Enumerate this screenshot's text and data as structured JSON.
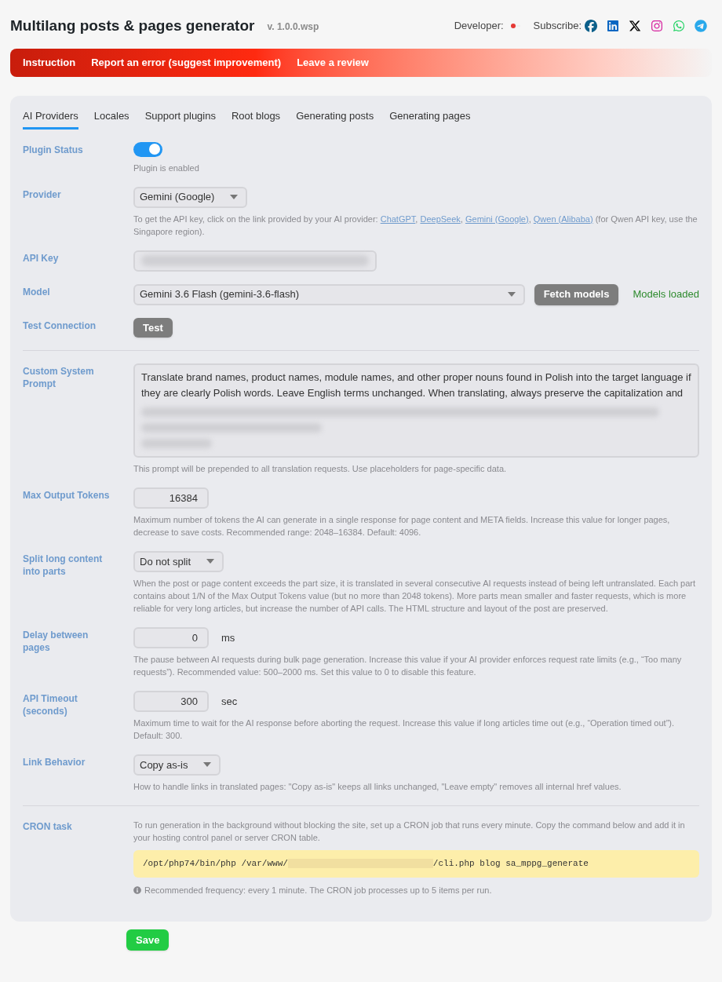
{
  "header": {
    "title": "Multilang posts & pages generator",
    "version": "v. 1.0.0.wsp",
    "developer_label": "Developer:",
    "subscribe_label": "Subscribe:"
  },
  "banner_links": [
    "Instruction",
    "Report an error (suggest improvement)",
    "Leave a review"
  ],
  "tabs": [
    {
      "label": "AI Providers",
      "selected": true
    },
    {
      "label": "Locales",
      "selected": false
    },
    {
      "label": "Support plugins",
      "selected": false
    },
    {
      "label": "Root blogs",
      "selected": false
    },
    {
      "label": "Generating posts",
      "selected": false
    },
    {
      "label": "Generating pages",
      "selected": false
    }
  ],
  "rows": [
    {
      "kind": "toggle",
      "label": "Plugin Status",
      "on": true,
      "help": "Plugin is enabled"
    },
    {
      "kind": "select",
      "label": "Provider",
      "value": "Gemini (Google)",
      "help_parts": [
        {
          "kind": "text",
          "text": "To get the API key, click on the link provided by your AI provider: "
        },
        {
          "kind": "link",
          "text": "ChatGPT"
        },
        {
          "kind": "text",
          "text": ", "
        },
        {
          "kind": "link",
          "text": "DeepSeek"
        },
        {
          "kind": "text",
          "text": ", "
        },
        {
          "kind": "link",
          "text": "Gemini (Google)"
        },
        {
          "kind": "text",
          "text": ", "
        },
        {
          "kind": "link",
          "text": "Qwen (Alibaba)"
        },
        {
          "kind": "text",
          "text": " (for Qwen API key, use the Singapore region)."
        }
      ]
    },
    {
      "kind": "secret",
      "label": "API Key"
    },
    {
      "kind": "model",
      "label": "Model",
      "value": "Gemini 3.6 Flash (gemini-3.6-flash)",
      "button": "Fetch models",
      "status": "Models loaded"
    },
    {
      "kind": "button",
      "label": "Test Connection",
      "button": "Test"
    },
    {
      "kind": "divider"
    },
    {
      "kind": "textarea",
      "label": "Custom System Prompt",
      "value": "Translate brand names, product names, module names, and other proper nouns found in Polish into the target language if they are clearly Polish words. Leave English terms unchanged. When translating, always preserve the capitalization and",
      "help": "This prompt will be prepended to all translation requests. Use placeholders for page-specific data."
    },
    {
      "kind": "number",
      "label": "Max Output Tokens",
      "value": "16384",
      "help": "Maximum number of tokens the AI can generate in a single response for page content and META fields. Increase this value for longer pages, decrease to save costs. Recommended range: 2048–16384. Default: 4096."
    },
    {
      "kind": "select",
      "label": "Split long content into parts",
      "value": "Do not split",
      "help": "When the post or page content exceeds the part size, it is translated in several consecutive AI requests instead of being left untranslated. Each part contains about 1/N of the Max Output Tokens value (but no more than 2048 tokens). More parts mean smaller and faster requests, which is more reliable for very long articles, but increase the number of API calls. The HTML structure and layout of the post are preserved."
    },
    {
      "kind": "number",
      "label": "Delay between pages",
      "value": "0",
      "unit": "ms",
      "help": "The pause between AI requests during bulk page generation. Increase this value if your AI provider enforces request rate limits (e.g., “Too many requests”). Recommended value: 500–2000 ms. Set this value to 0 to disable this feature."
    },
    {
      "kind": "number",
      "label": "API Timeout (seconds)",
      "value": "300",
      "unit": "sec",
      "help": "Maximum time to wait for the AI response before aborting the request. Increase this value if long articles time out (e.g., “Operation timed out”). Default: 300."
    },
    {
      "kind": "select",
      "label": "Link Behavior",
      "value": "Copy as-is",
      "help": "How to handle links in translated pages: \"Copy as-is\" keeps all links unchanged, \"Leave empty\" removes all internal href values."
    },
    {
      "kind": "divider"
    },
    {
      "kind": "cron",
      "label": "CRON task",
      "text": "To run generation in the background without blocking the site, set up a CRON job that runs every minute. Copy the command below and add it in your hosting control panel or server CRON table.",
      "command_start": "/opt/php74/bin/php /var/www/",
      "command_end": "/cli.php blog sa_mppg_generate",
      "note": "Recommended frequency: every 1 minute. The CRON job processes up to 5 items per run."
    }
  ],
  "save_button": "Save"
}
